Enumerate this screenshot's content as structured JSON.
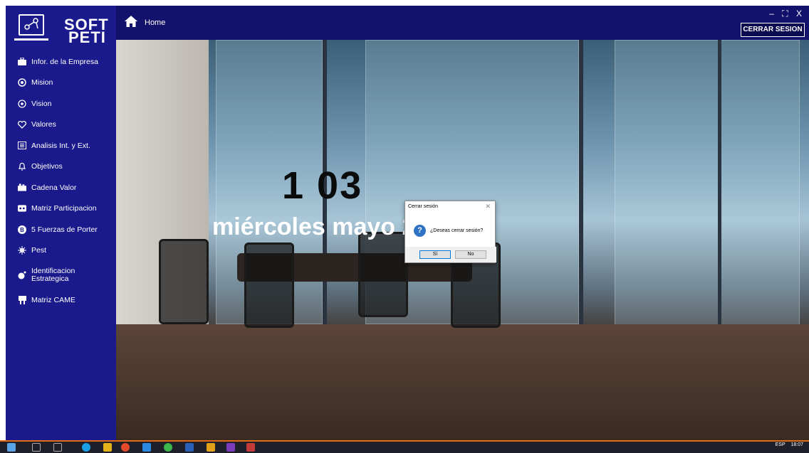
{
  "app": {
    "logo": {
      "line1": "SOFT",
      "line2": "PETI"
    },
    "window_controls": "– ⛶ X",
    "logout_label": "CERRAR SESION",
    "breadcrumb": "Home"
  },
  "sidebar": {
    "items": [
      {
        "label": "Infor. de la Empresa",
        "icon": "briefcase-icon"
      },
      {
        "label": "Mision",
        "icon": "target-icon"
      },
      {
        "label": "Vision",
        "icon": "eye-icon"
      },
      {
        "label": "Valores",
        "icon": "heart-icon"
      },
      {
        "label": "Analisis Int. y Ext.",
        "icon": "list-icon"
      },
      {
        "label": "Objetivos",
        "icon": "bell-icon"
      },
      {
        "label": "Cadena Valor",
        "icon": "chain-icon"
      },
      {
        "label": "Matriz Participacion",
        "icon": "matrix-icon"
      },
      {
        "label": "5 Fuerzas de Porter",
        "icon": "forces-icon"
      },
      {
        "label": "Pest",
        "icon": "pest-icon"
      },
      {
        "label": "Identificacion Estrategica",
        "icon": "strategy-icon"
      },
      {
        "label": "Matriz CAME",
        "icon": "came-icon"
      }
    ]
  },
  "hero": {
    "time": "1 03",
    "date": "miércoles mayo 2025"
  },
  "dialog": {
    "title": "Cerrar sesión",
    "message": "¿Deseas cerrar sesión?",
    "yes_label": "Sí",
    "no_label": "No",
    "icon": "question-icon"
  },
  "tray": {
    "lang": "ESP",
    "time": "18:07"
  },
  "colors": {
    "sidebar": "#1a1a8c",
    "topbar": "#12116b",
    "taskbar_accent": "#e26b1a"
  }
}
